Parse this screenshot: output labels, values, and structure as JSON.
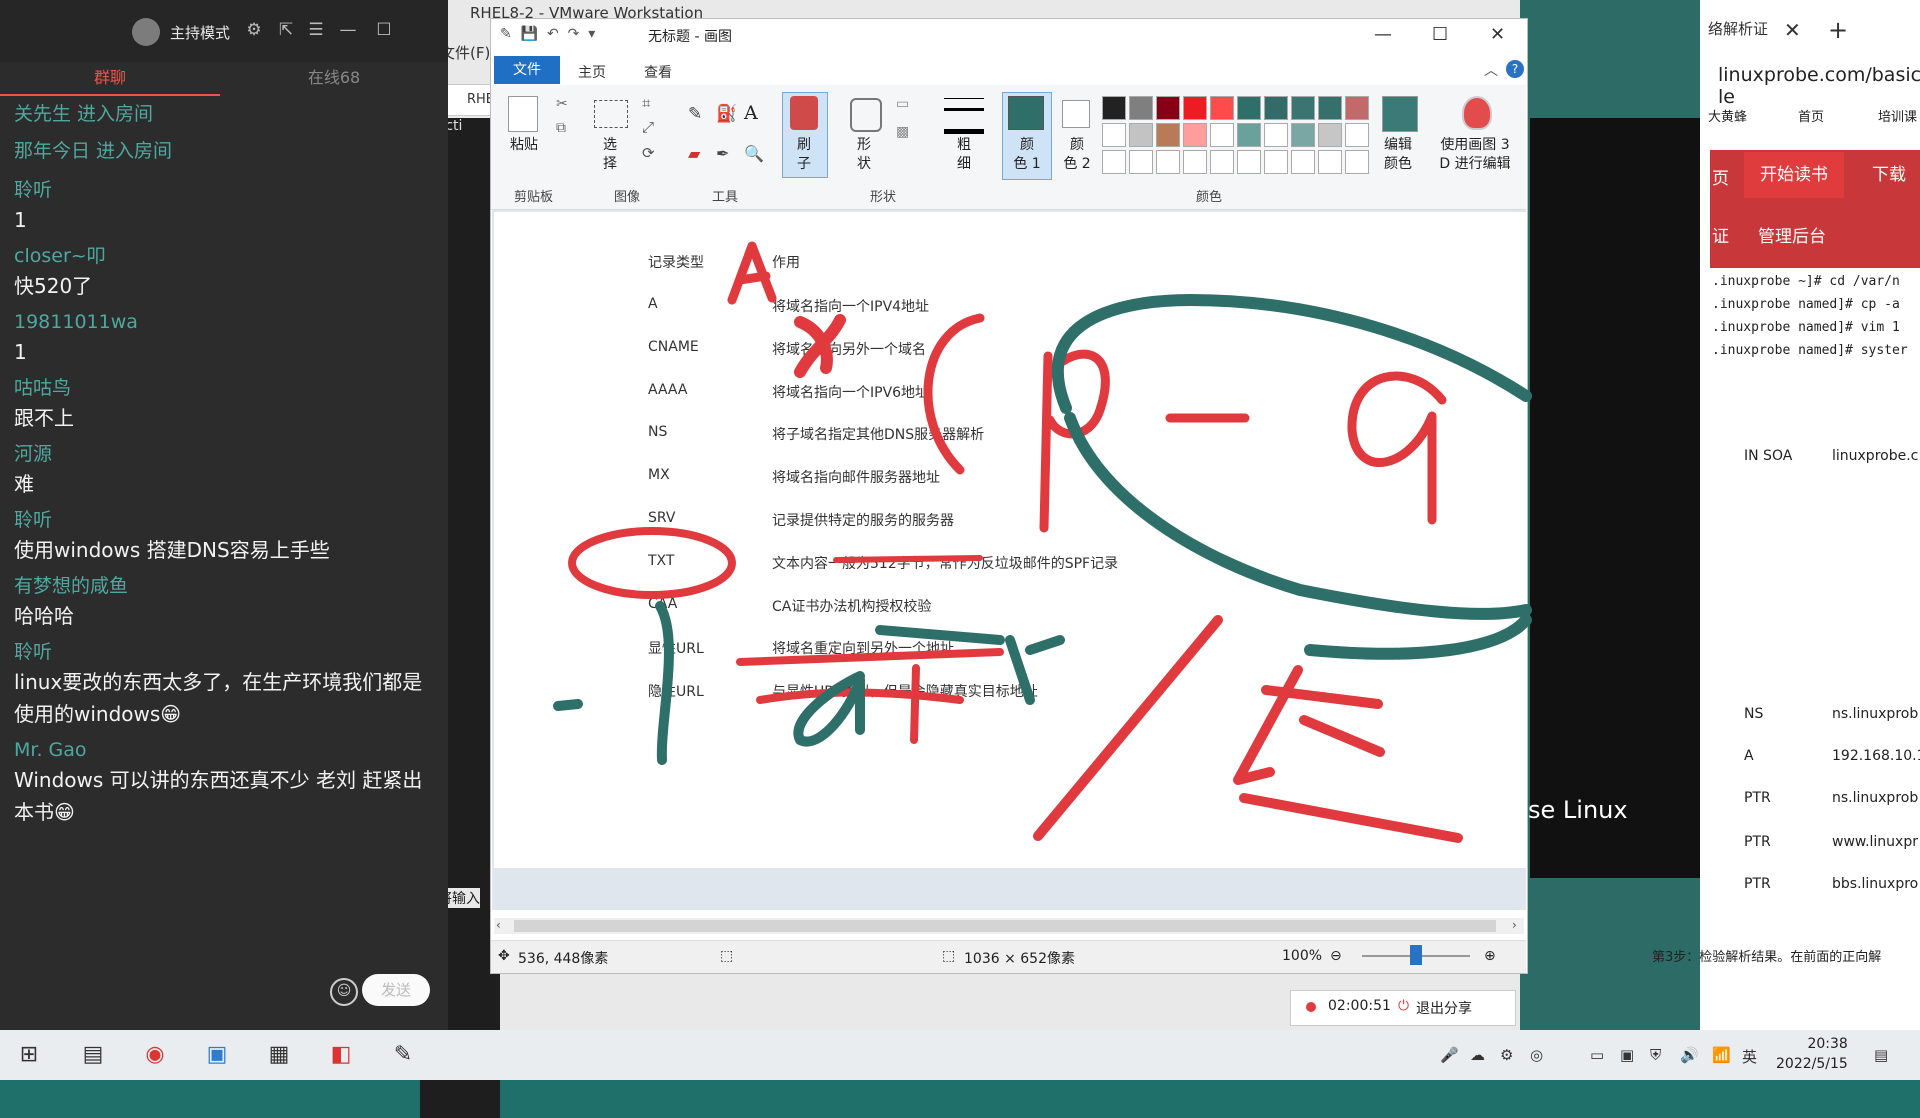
{
  "chat": {
    "host_mode": "主持模式",
    "tabs": [
      "群聊",
      "在线68"
    ],
    "system_messages": [
      "关先生 进入房间",
      "那年今日 进入房间"
    ],
    "messages": [
      {
        "nick": "聆听",
        "text": "1"
      },
      {
        "nick": "closer~叩",
        "text": "快520了"
      },
      {
        "nick": "19811011wa",
        "text": "1"
      },
      {
        "nick": "咕咕鸟",
        "text": "跟不上"
      },
      {
        "nick": "河源",
        "text": "难"
      },
      {
        "nick": "聆听",
        "text": "使用windows 搭建DNS容易上手些"
      },
      {
        "nick": "有梦想的咸鱼",
        "text": "哈哈哈"
      },
      {
        "nick": "聆听",
        "text": "linux要改的东西太多了，在生产环境我们都是使用的windows😁"
      },
      {
        "nick": "Mr. Gao",
        "text": "Windows 可以讲的东西还真不少  老刘 赶紧出本书😁"
      }
    ],
    "send_label": "发送"
  },
  "vmware": {
    "title": "RHEL8-2 - VMware Workstation",
    "menu_file": "文件(F)",
    "tab_label": "RHE",
    "act_label": "Acti",
    "tip": "要将输入"
  },
  "paint": {
    "title": "无标题 - 画图",
    "tabs": {
      "file": "文件",
      "home": "主页",
      "view": "查看"
    },
    "ribbon": {
      "paste": "粘贴",
      "select": "选\n择",
      "brush": "刷\n子",
      "shape": "形\n状",
      "size": "粗\n细",
      "color1": "颜\n色 1",
      "color2": "颜\n色 2",
      "edit_colors": "编辑\n颜色",
      "paint3d": "使用画图 3\nD 进行编辑"
    },
    "groups": {
      "clipboard": "剪贴板",
      "image": "图像",
      "tools": "工具",
      "shapes": "形状",
      "colors": "颜色"
    },
    "palette": [
      "#222222",
      "#7f7f7f",
      "#880015",
      "#ed1c24",
      "#ff4b4b",
      "#2f6f6a",
      "#336b68",
      "#3b7571",
      "#36706c",
      "#c26a6a",
      "#ffffff",
      "#c3c3c3",
      "#b97a57",
      "#ff9c9c",
      "#ffffff",
      "#6aa19d",
      "#ffffff",
      "#7aa7a4",
      "#c6c6c6",
      "#ffffff",
      "#ffffff",
      "#ffffff",
      "#ffffff",
      "#ffffff",
      "#ffffff",
      "#ffffff",
      "#ffffff",
      "#ffffff",
      "#ffffff",
      "#ffffff"
    ],
    "color1": "#2f6f6a",
    "color2": "#ffffff",
    "table_header": {
      "type": "记录类型",
      "purpose": "作用"
    },
    "table_rows": [
      {
        "type": "A",
        "purpose": "将域名指向一个IPV4地址"
      },
      {
        "type": "CNAME",
        "purpose": "将域名指向另外一个域名"
      },
      {
        "type": "AAAA",
        "purpose": "将域名指向一个IPV6地址"
      },
      {
        "type": "NS",
        "purpose": "将子域名指定其他DNS服务器解析"
      },
      {
        "type": "MX",
        "purpose": "将域名指向邮件服务器地址"
      },
      {
        "type": "SRV",
        "purpose": "记录提供特定的服务的服务器"
      },
      {
        "type": "TXT",
        "purpose": "文本内容一般为512字节，常作为反垃圾邮件的SPF记录"
      },
      {
        "type": "CAA",
        "purpose": "CA证书办法机构授权校验"
      },
      {
        "type": "显性URL",
        "purpose": "将域名重定向到另外一个地址"
      },
      {
        "type": "隐性URL",
        "purpose": "与显性URL类似，但是会隐藏真实目标地址"
      }
    ],
    "status": {
      "cursor": "536, 448像素",
      "size": "1036 × 652像素",
      "zoom": "100%"
    },
    "zoom_level": 0.5
  },
  "browser": {
    "tab_title": "络解析证",
    "url": "linuxprobe.com/basic-le",
    "bookmarks": [
      "大黄蜂",
      "首页",
      "培训课"
    ],
    "nav": {
      "read": "开始读书",
      "download": "下载",
      "admin": "管理后台",
      "zheng": "证",
      "ye": "页"
    },
    "terminal": [
      ".inuxprobe ~]# cd /var/n",
      ".inuxprobe named]# cp -a",
      ".inuxprobe named]# vim 1",
      ".inuxprobe named]# syster"
    ],
    "soa": {
      "type": "IN SOA",
      "value": "linuxprobe.c"
    },
    "dns_records": [
      {
        "type": "NS",
        "value": "ns.linuxprob"
      },
      {
        "type": "A",
        "value": "192.168.10.1"
      },
      {
        "type": "PTR",
        "value": "ns.linuxprob"
      },
      {
        "type": "PTR",
        "value": "www.linuxpr"
      },
      {
        "type": "PTR",
        "value": "bbs.linuxpro"
      }
    ],
    "step": "第3步：检验解析结果。在前面的正向解"
  },
  "vm_linux_text": "se Linux",
  "share": {
    "time": "02:00:51",
    "exit": "退出分享"
  },
  "taskbar": {
    "time": "20:38",
    "date": "2022/5/15",
    "ime": "英"
  }
}
